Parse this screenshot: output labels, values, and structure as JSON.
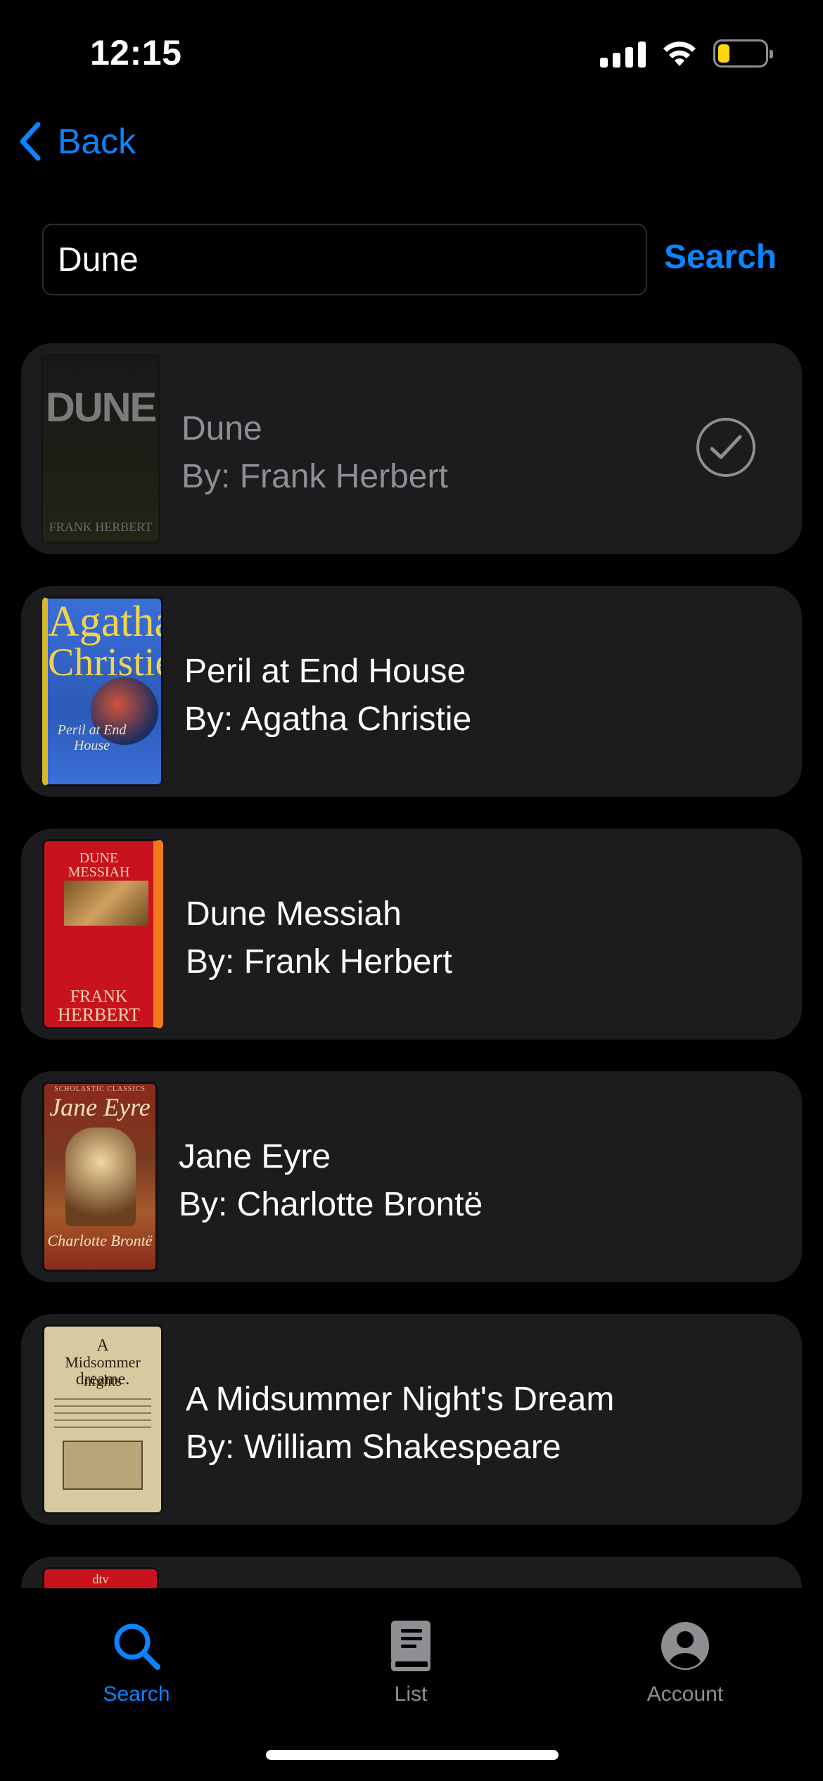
{
  "status_bar": {
    "time": "12:15",
    "battery_level": 0.25
  },
  "nav": {
    "back_label": "Back"
  },
  "search": {
    "value": "Dune",
    "button_label": "Search"
  },
  "results": [
    {
      "title": "Dune",
      "author": "By: Frank Herbert",
      "added": true,
      "cover": {
        "text": "DUNE",
        "author": "FRANK HERBERT"
      }
    },
    {
      "title": "Peril at End House",
      "author": "By: Agatha Christie",
      "added": false,
      "cover": {
        "line1": "Agatha",
        "line2": "Christie",
        "sub": "Peril at End House"
      }
    },
    {
      "title": "Dune Messiah",
      "author": "By: Frank Herbert",
      "added": false,
      "cover": {
        "top": "DUNE MESSIAH",
        "author1": "FRANK",
        "author2": "HERBERT"
      }
    },
    {
      "title": "Jane Eyre",
      "author": "By: Charlotte Brontë",
      "added": false,
      "cover": {
        "top": "SCHOLASTIC CLASSICS",
        "title": "Jane Eyre",
        "author": "Charlotte Brontë"
      }
    },
    {
      "title": "A Midsummer Night's Dream",
      "author": "By: William Shakespeare",
      "added": false,
      "cover": {
        "line1": "A",
        "line2": "Midsommer nights",
        "line3": "dreame."
      }
    },
    {
      "cover": {
        "top": "dtv"
      }
    }
  ],
  "tabs": [
    {
      "label": "Search",
      "icon": "magnifier-icon",
      "active": true
    },
    {
      "label": "List",
      "icon": "book-icon",
      "active": false
    },
    {
      "label": "Account",
      "icon": "person-circle-icon",
      "active": false
    }
  ],
  "colors": {
    "accent": "#0a84ff",
    "card": "#1c1c1e",
    "muted": "#8e8e93"
  }
}
